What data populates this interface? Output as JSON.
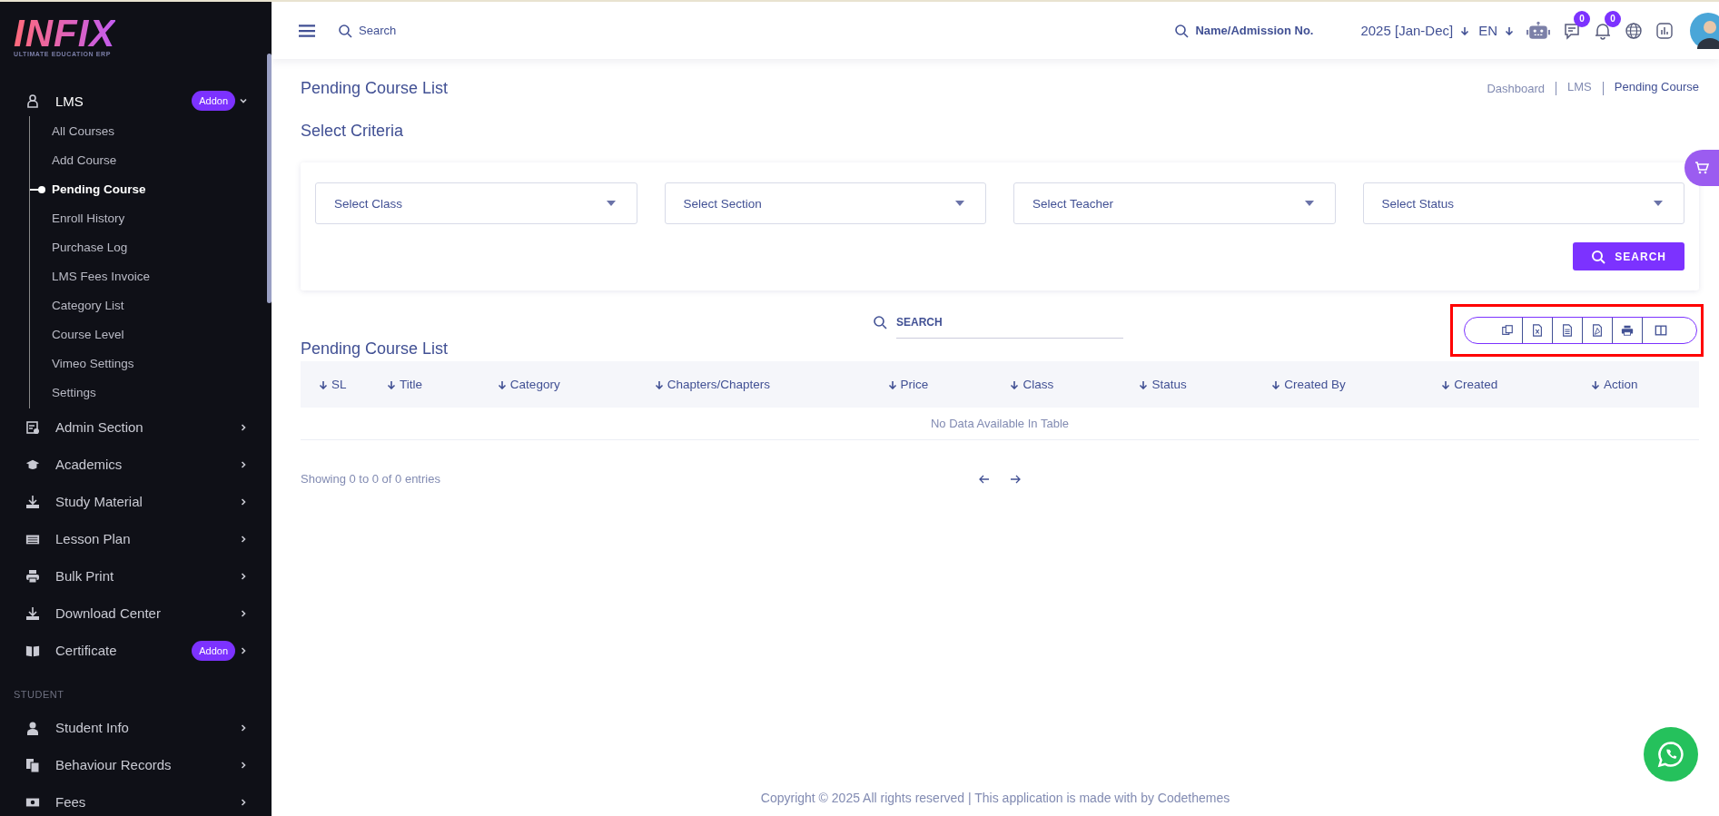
{
  "logo": {
    "wordmark": "INFIX",
    "tagline": "ULTIMATE EDUCATION ERP"
  },
  "sidebar": {
    "groups": [
      {
        "items": [
          {
            "label": "LMS",
            "badge": "Addon",
            "expanded": true,
            "children": [
              {
                "label": "All Courses",
                "selected": false
              },
              {
                "label": "Add Course",
                "selected": false
              },
              {
                "label": "Pending Course",
                "selected": true
              },
              {
                "label": "Enroll History",
                "selected": false
              },
              {
                "label": "Purchase Log",
                "selected": false
              },
              {
                "label": "LMS Fees Invoice",
                "selected": false
              },
              {
                "label": "Category List",
                "selected": false
              },
              {
                "label": "Course Level",
                "selected": false
              },
              {
                "label": "Vimeo Settings",
                "selected": false
              },
              {
                "label": "Settings",
                "selected": false
              }
            ]
          },
          {
            "label": "Admin Section",
            "expanded": false
          },
          {
            "label": "Academics",
            "expanded": false
          },
          {
            "label": "Study Material",
            "expanded": false
          },
          {
            "label": "Lesson Plan",
            "expanded": false
          },
          {
            "label": "Bulk Print",
            "expanded": false
          },
          {
            "label": "Download Center",
            "expanded": false
          },
          {
            "label": "Certificate",
            "badge": "Addon",
            "expanded": false
          }
        ]
      },
      {
        "heading": "STUDENT",
        "items": [
          {
            "label": "Student Info",
            "expanded": false
          },
          {
            "label": "Behaviour Records",
            "expanded": false
          },
          {
            "label": "Fees",
            "expanded": false
          }
        ]
      }
    ]
  },
  "header": {
    "search": {
      "placeholder": "Search"
    },
    "student_search": {
      "placeholder": "Name/Admission No."
    },
    "session": "2025 [Jan-Dec]",
    "language": "EN",
    "chat_badge": "0",
    "notification_badge": "0"
  },
  "page": {
    "title": "Pending Course List",
    "breadcrumbs": [
      {
        "label": "Dashboard",
        "selected": false
      },
      {
        "label": "LMS",
        "selected": false
      },
      {
        "label": "Pending Course",
        "selected": true
      }
    ],
    "criteria": {
      "title": "Select Criteria",
      "selects": [
        {
          "placeholder": "Select Class"
        },
        {
          "placeholder": "Select Section"
        },
        {
          "placeholder": "Select Teacher"
        },
        {
          "placeholder": "Select Status"
        }
      ],
      "button": "SEARCH"
    },
    "table": {
      "title": "Pending Course List",
      "search": {
        "placeholder": "SEARCH"
      },
      "columns": [
        "SL",
        "Title",
        "Category",
        "Chapters/Chapters",
        "Price",
        "Class",
        "Status",
        "Created By",
        "Created",
        "Action"
      ],
      "empty_message": "No Data Available In Table",
      "info": "Showing 0 to 0 of 0 entries"
    }
  },
  "footer": {
    "copyright": "Copyright © 2025 All rights reserved | This application is made with by Codethemes"
  }
}
